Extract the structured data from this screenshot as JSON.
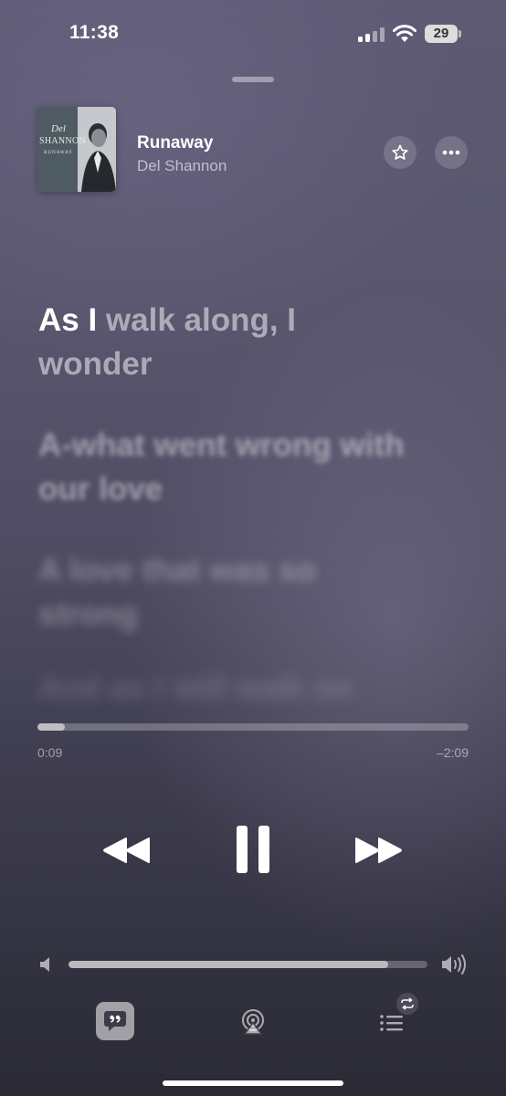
{
  "status_bar": {
    "time": "11:38",
    "battery": "29"
  },
  "now_playing": {
    "title": "Runaway",
    "artist": "Del Shannon",
    "artwork": {
      "script": "Del",
      "name": "SHANNON",
      "album": "RUNAWAY"
    }
  },
  "lyrics": {
    "current_sung": "As I",
    "current_unsung": " walk along, I wonder",
    "upcoming": [
      "A-what went wrong with our love",
      "A love that was so strong",
      "And as I still walk on"
    ]
  },
  "playback": {
    "elapsed": "0:09",
    "remaining": "–2:09",
    "progress_fraction": 0.064,
    "volume_fraction": 0.89
  },
  "icons": {
    "favorite": "star-icon",
    "more": "ellipsis-icon",
    "previous": "rewind-icon",
    "play_pause": "pause-icon",
    "next": "fast-forward-icon",
    "lyrics": "lyrics-quote-icon",
    "airplay": "airplay-icon",
    "queue": "queue-list-icon",
    "repeat": "repeat-icon"
  },
  "colors": {
    "background_top": "#5e5a74",
    "background_bottom": "#2a2a35",
    "lyrics_active": "#ffffff"
  }
}
